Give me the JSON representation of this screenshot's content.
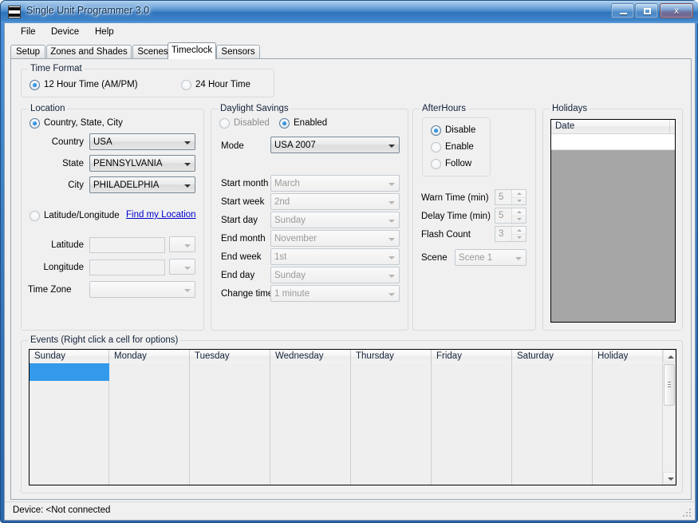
{
  "window": {
    "title": "Single Unit Programmer 3.0",
    "icon": "app-stripes-icon",
    "minimize_label": "",
    "maximize_label": "",
    "close_label": "x"
  },
  "menu": {
    "items": [
      {
        "label": "File"
      },
      {
        "label": "Device"
      },
      {
        "label": "Help"
      }
    ]
  },
  "tabs": {
    "items": [
      {
        "label": "Setup",
        "active": false
      },
      {
        "label": "Zones and Shades",
        "active": false
      },
      {
        "label": "Scenes",
        "active": false
      },
      {
        "label": "Timeclock",
        "active": true
      },
      {
        "label": "Sensors",
        "active": false
      }
    ]
  },
  "time_format": {
    "caption": "Time Format",
    "options": [
      {
        "label": "12 Hour Time (AM/PM)",
        "selected": true
      },
      {
        "label": "24 Hour Time",
        "selected": false
      }
    ]
  },
  "location": {
    "caption": "Location",
    "mode_country": {
      "label": "Country, State, City",
      "selected": true
    },
    "mode_latlon": {
      "label": "Latitude/Longitude",
      "selected": false
    },
    "find_link": "Find my Location",
    "fields": [
      {
        "label": "Country",
        "value": "USA",
        "enabled": true
      },
      {
        "label": "State",
        "value": "PENNSYLVANIA",
        "enabled": true
      },
      {
        "label": "City",
        "value": "PHILADELPHIA",
        "enabled": true
      }
    ],
    "latitude": {
      "label": "Latitude",
      "value": "",
      "unit": ""
    },
    "longitude": {
      "label": "Longitude",
      "value": "",
      "unit": ""
    },
    "timezone": {
      "label": "Time Zone",
      "value": ""
    }
  },
  "daylight_savings": {
    "caption": "Daylight Savings",
    "disabled_option": {
      "label": "Disabled",
      "selected": false
    },
    "enabled_option": {
      "label": "Enabled",
      "selected": true
    },
    "mode": {
      "label": "Mode",
      "value": "USA 2007"
    },
    "rows": [
      {
        "label": "Start month",
        "value": "March"
      },
      {
        "label": "Start week",
        "value": "2nd"
      },
      {
        "label": "Start day",
        "value": "Sunday"
      },
      {
        "label": "End month",
        "value": "November"
      },
      {
        "label": "End week",
        "value": "1st"
      },
      {
        "label": "End day",
        "value": "Sunday"
      },
      {
        "label": "Change time",
        "value": "1 minute"
      }
    ]
  },
  "afterhours": {
    "caption": "AfterHours",
    "options": [
      {
        "label": "Disable",
        "selected": true
      },
      {
        "label": "Enable",
        "selected": false
      },
      {
        "label": "Follow",
        "selected": false
      }
    ],
    "spinners": [
      {
        "label": "Warn Time (min)",
        "value": "5"
      },
      {
        "label": "Delay Time (min)",
        "value": "5"
      },
      {
        "label": "Flash Count",
        "value": "3"
      }
    ],
    "scene": {
      "label": "Scene",
      "value": "Scene 1"
    }
  },
  "holidays": {
    "caption": "Holidays",
    "columns": [
      "Date"
    ],
    "rows": [
      [
        ""
      ]
    ]
  },
  "events": {
    "caption": "Events (Right click a cell for options)",
    "columns": [
      "Sunday",
      "Monday",
      "Tuesday",
      "Wednesday",
      "Thursday",
      "Friday",
      "Saturday",
      "Holiday"
    ],
    "row_count": 9,
    "selected_cell": {
      "row": 0,
      "column": 0
    },
    "selection_color": "#3399ea",
    "cells": [
      [
        "",
        "",
        "",
        "",
        "",
        "",
        "",
        ""
      ],
      [
        "",
        "",
        "",
        "",
        "",
        "",
        "",
        ""
      ],
      [
        "",
        "",
        "",
        "",
        "",
        "",
        "",
        ""
      ],
      [
        "",
        "",
        "",
        "",
        "",
        "",
        "",
        ""
      ],
      [
        "",
        "",
        "",
        "",
        "",
        "",
        "",
        ""
      ],
      [
        "",
        "",
        "",
        "",
        "",
        "",
        "",
        ""
      ],
      [
        "",
        "",
        "",
        "",
        "",
        "",
        "",
        ""
      ],
      [
        "",
        "",
        "",
        "",
        "",
        "",
        "",
        ""
      ],
      [
        "",
        "",
        "",
        "",
        "",
        "",
        "",
        ""
      ]
    ]
  },
  "statusbar": {
    "text": "Device: <Not connected"
  },
  "colors": {
    "titlebar_accent": "#3f84c9",
    "selection": "#3399ea",
    "link": "#0000cc",
    "disabled_text": "#9a9a9a",
    "holiday_list_bg": "#a6a6a6"
  }
}
